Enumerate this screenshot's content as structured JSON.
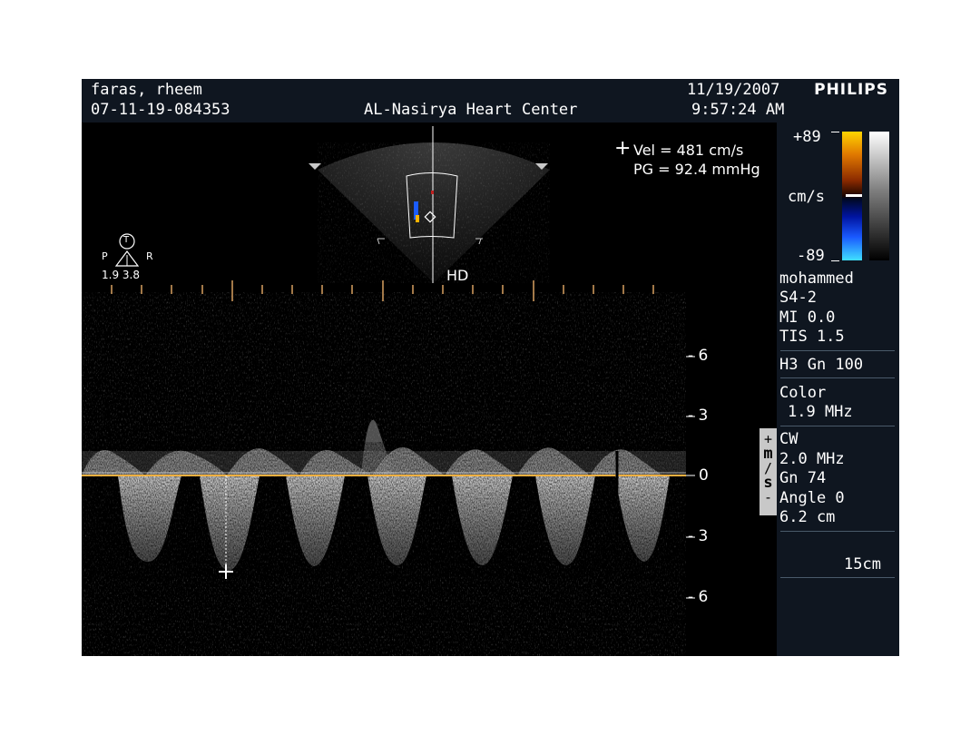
{
  "header": {
    "patient_name": "faras, rheem",
    "patient_id": "07-11-19-084353",
    "institution": "AL-Nasirya Heart Center",
    "date": "11/19/2007",
    "time": "9:57:24 AM",
    "brand": "PHILIPS"
  },
  "measurement": {
    "vel_line": "Vel = 481 cm/s",
    "pg_line": "PG = 92.4 mmHg"
  },
  "probe_indicator": {
    "tee_label": "T",
    "p_label": "P",
    "r_label": "R",
    "values": "1.9 3.8"
  },
  "sector": {
    "hd_label": "HD"
  },
  "color_scale": {
    "top": "+89",
    "unit": "cm/s",
    "bottom": "-89"
  },
  "settings": {
    "operator": "mohammed",
    "probe": "S4-2",
    "mi": "MI 0.0",
    "tis": "TIS 1.5",
    "harmonics": "H3  Gn 100",
    "color_label": "Color",
    "color_freq": "1.9 MHz",
    "mode": "CW",
    "cw_freq": "2.0 MHz",
    "cw_gain": "Gn 74",
    "angle": "Angle 0",
    "depth_cm": "6.2 cm",
    "depth_total": "15cm"
  },
  "doppler_axis": {
    "labels": [
      "- 6",
      "- 3",
      "0",
      "- 3",
      "- 6"
    ],
    "unit_chars": [
      "+",
      "m",
      "/",
      "s",
      "-"
    ]
  },
  "colors": {
    "baseline": "#f0b040",
    "panel": "#0f1620",
    "tick_orange": "#d8a060"
  }
}
